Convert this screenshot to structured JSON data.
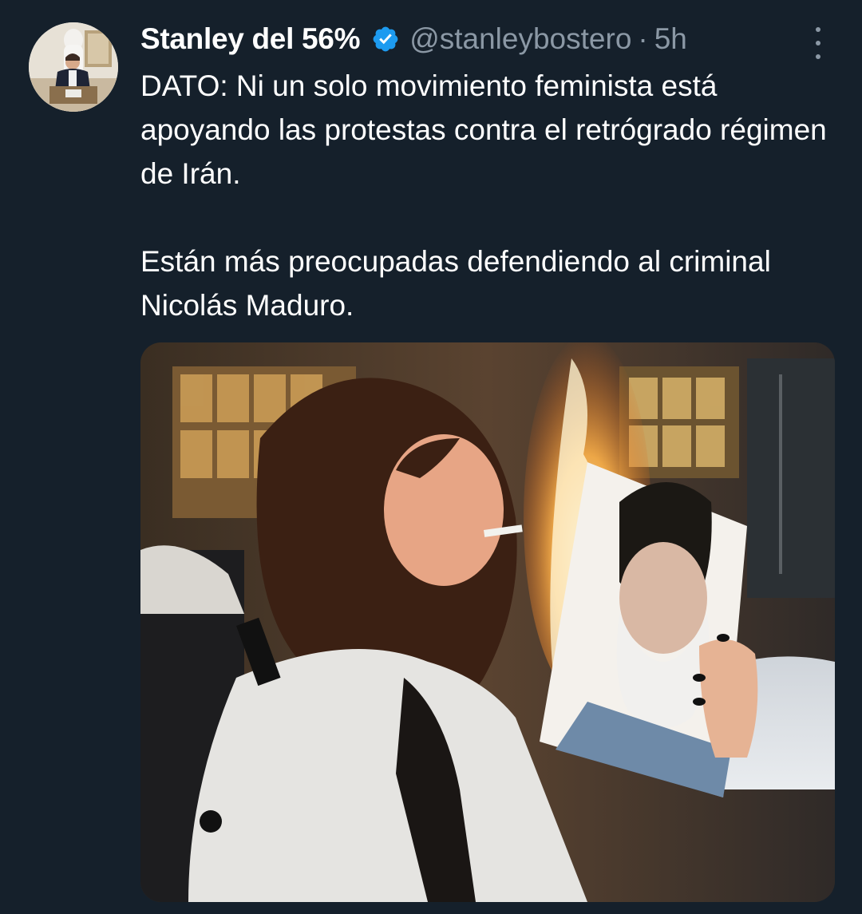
{
  "tweet": {
    "author": {
      "display_name": "Stanley del 56%",
      "handle": "@stanleybostero",
      "verified": true,
      "avatar": "avatar-photo"
    },
    "separator": "·",
    "time": "5h",
    "more_icon": "more-vertical-icon",
    "text": {
      "paragraph_1": "DATO: Ni un solo movimiento feminista está apoyando las protestas contra el retrógrado régimen de Irán.",
      "paragraph_2": "Están más preocupadas defendiendo al criminal Nicolás Maduro."
    },
    "media": {
      "kind": "photo"
    }
  },
  "colors": {
    "background": "#15202b",
    "primary_text": "#ffffff",
    "secondary_text": "#8b98a5",
    "verified_badge": "#1d9bf0"
  }
}
